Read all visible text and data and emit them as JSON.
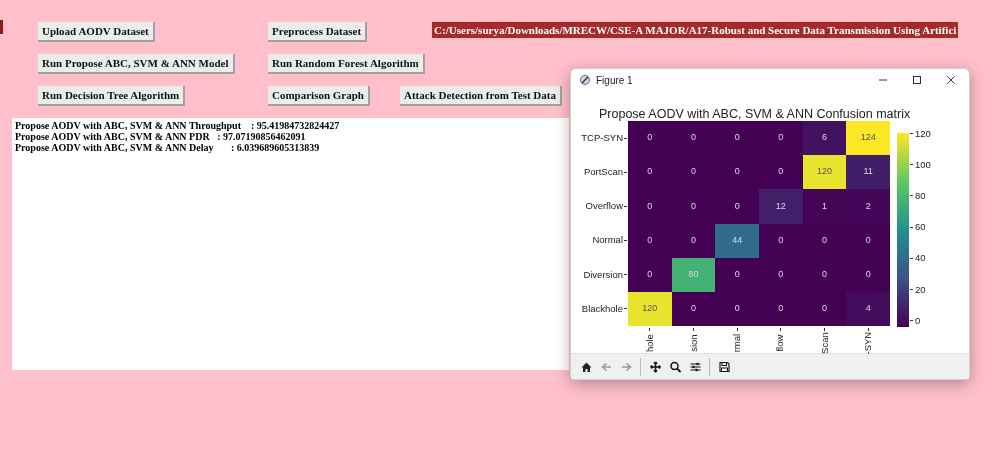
{
  "button_rows": [
    [
      "Upload AODV Dataset",
      "Preprocess Dataset"
    ],
    [
      "Run Propose ABC, SVM & ANN Model",
      "Run Random Forest Algorithm"
    ],
    [
      "Run Decision Tree Algorithm",
      "Comparison Graph",
      "Attack Detection from Test Data"
    ]
  ],
  "path_label": "C:/Users/surya/Downloads/MRECW/CSE-A MAJOR/A17-Robust and Secure Data Transmission Using Artifici",
  "output_lines": [
    "Propose AODV with ABC, SVM & ANN Throughput    : 95.41984732824427",
    "Propose AODV with ABC, SVM & ANN PDR   : 97.07190856462091",
    "Propose AODV with ABC, SVM & ANN Delay       : 6.039689605313839"
  ],
  "figure_window": {
    "title": "Figure 1",
    "plot_title": "Propose AODV with ABC, SVM & ANN Confusion matrix",
    "row_labels": [
      "TCP-SYN",
      "PortScan",
      "Overflow",
      "Normal",
      "Diversion",
      "Blackhole"
    ],
    "column_labels": [
      "hole",
      "sion",
      "rmal",
      "flow",
      "Scan",
      "-SYN"
    ],
    "cells": [
      [
        "0",
        "0",
        "0",
        "0",
        "6",
        "124"
      ],
      [
        "0",
        "0",
        "0",
        "0",
        "120",
        "11"
      ],
      [
        "0",
        "0",
        "0",
        "12",
        "1",
        "2"
      ],
      [
        "0",
        "0",
        "44",
        "0",
        "0",
        "0"
      ],
      [
        "0",
        "80",
        "0",
        "0",
        "0",
        "0"
      ],
      [
        "120",
        "0",
        "0",
        "0",
        "0",
        "4"
      ]
    ],
    "colorbar_ticks": [
      "120",
      "100",
      "80",
      "60",
      "40",
      "20",
      "0"
    ]
  }
}
